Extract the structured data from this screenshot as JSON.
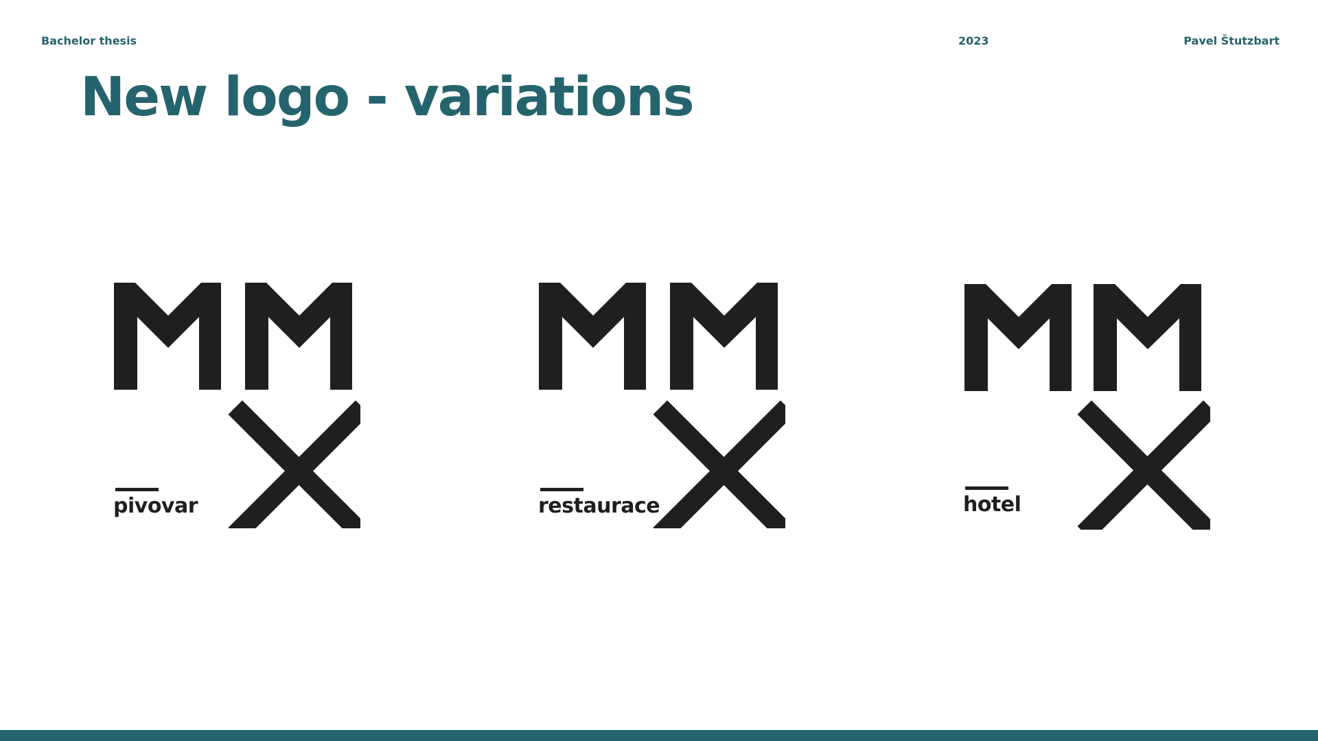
{
  "header": {
    "left": "Bachelor thesis",
    "center": "2023",
    "right": "Pavel Štutzbart"
  },
  "title": "New logo - variations",
  "logos": [
    {
      "label": "pivovar"
    },
    {
      "label": "restaurace"
    },
    {
      "label": "hotel"
    }
  ],
  "colors": {
    "accent": "#25646d",
    "logo": "#1f1f1f",
    "background": "#ffffff"
  }
}
